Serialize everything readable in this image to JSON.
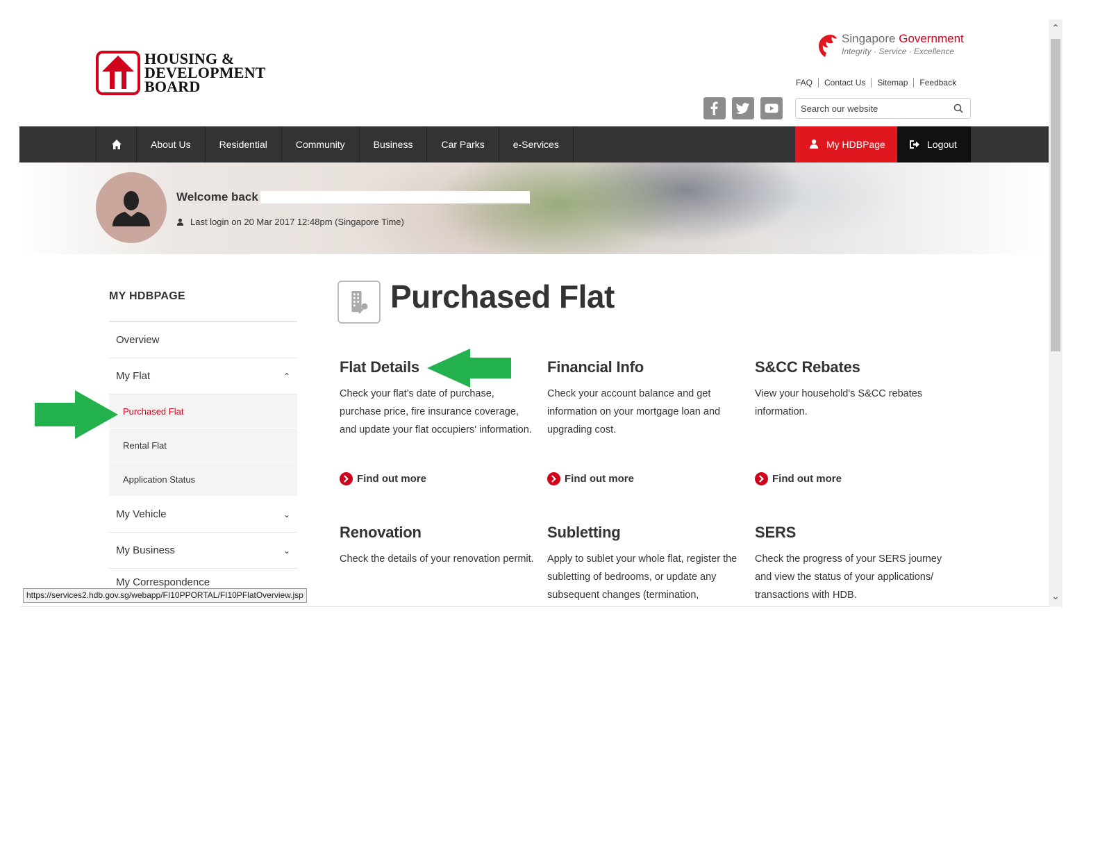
{
  "header": {
    "logo_text": "HOUSING & DEVELOPMENT BOARD",
    "logo_lines": [
      "HOUSING &",
      "DEVELOPMENT",
      "BOARD"
    ],
    "gov_title_1": "Singapore ",
    "gov_title_2": "Government",
    "gov_motto": "Integrity · Service · Excellence",
    "top_links": [
      "FAQ",
      "Contact Us",
      "Sitemap",
      "Feedback"
    ],
    "social_icons": [
      "facebook-icon",
      "twitter-icon",
      "youtube-icon"
    ],
    "search_placeholder": "Search our website"
  },
  "nav": {
    "items": [
      "About Us",
      "Residential",
      "Community",
      "Business",
      "Car Parks",
      "e-Services"
    ],
    "my_hdbpage": "My HDBPage",
    "logout": "Logout"
  },
  "banner": {
    "welcome": "Welcome back",
    "last_login": "Last login on 20 Mar 2017 12:48pm (Singapore Time)"
  },
  "sidebar": {
    "title": "MY HDBPAGE",
    "overview": "Overview",
    "my_flat": "My Flat",
    "sub_items": [
      "Purchased Flat",
      "Rental Flat",
      "Application Status"
    ],
    "my_vehicle": "My Vehicle",
    "my_business": "My Business",
    "my_correspondence": "My Correspondence"
  },
  "main": {
    "title": "Purchased Flat",
    "cards": [
      {
        "title": "Flat Details",
        "text": "Check your flat's date of purchase, purchase price, fire insurance coverage, and update your flat occupiers' information.",
        "link": "Find out more"
      },
      {
        "title": "Financial Info",
        "text": "Check your account balance and get information on your mortgage loan and upgrading cost.",
        "link": "Find out more"
      },
      {
        "title": "S&CC Rebates",
        "text": "View your household's S&CC rebates information.",
        "link": "Find out more"
      },
      {
        "title": "Renovation",
        "text": "Check the details of your renovation permit."
      },
      {
        "title": "Subletting",
        "text": "Apply to sublet your whole flat, register the subletting of bedrooms, or update any subsequent changes (termination,"
      },
      {
        "title": "SERS",
        "text": "Check the progress of your SERS journey and view the status of your applications/ transactions with HDB."
      }
    ]
  },
  "status_url": "https://services2.hdb.gov.sg/webapp/FI10PPORTAL/FI10PFlatOverview.jsp",
  "colors": {
    "brand_red": "#d0021b",
    "nav_dark": "#333333",
    "annotation_green": "#22b14c"
  }
}
